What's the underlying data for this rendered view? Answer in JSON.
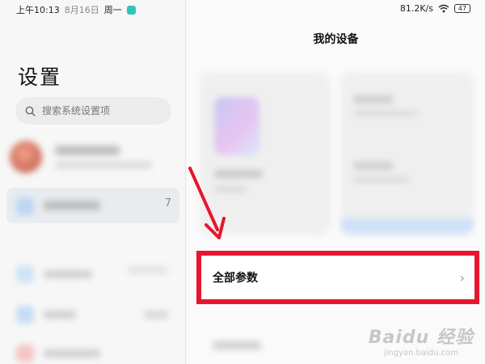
{
  "status_bar": {
    "left": {
      "time": "上午10:13",
      "date": "8月16日",
      "weekday": "周一"
    },
    "right": {
      "speed": "81.2K/s",
      "battery": "47"
    }
  },
  "settings": {
    "title": "设置",
    "search_placeholder": "搜索系统设置项",
    "selected_row_count": "7"
  },
  "right_panel": {
    "title": "我的设备",
    "all_params_label": "全部参数"
  },
  "colors": {
    "highlight_border": "#e8152e",
    "arrow": "#e8152e",
    "accent_teal": "#2ec4b6"
  },
  "watermark": {
    "main": "Baidu 经验",
    "sub": "jingyan.baidu.com"
  }
}
